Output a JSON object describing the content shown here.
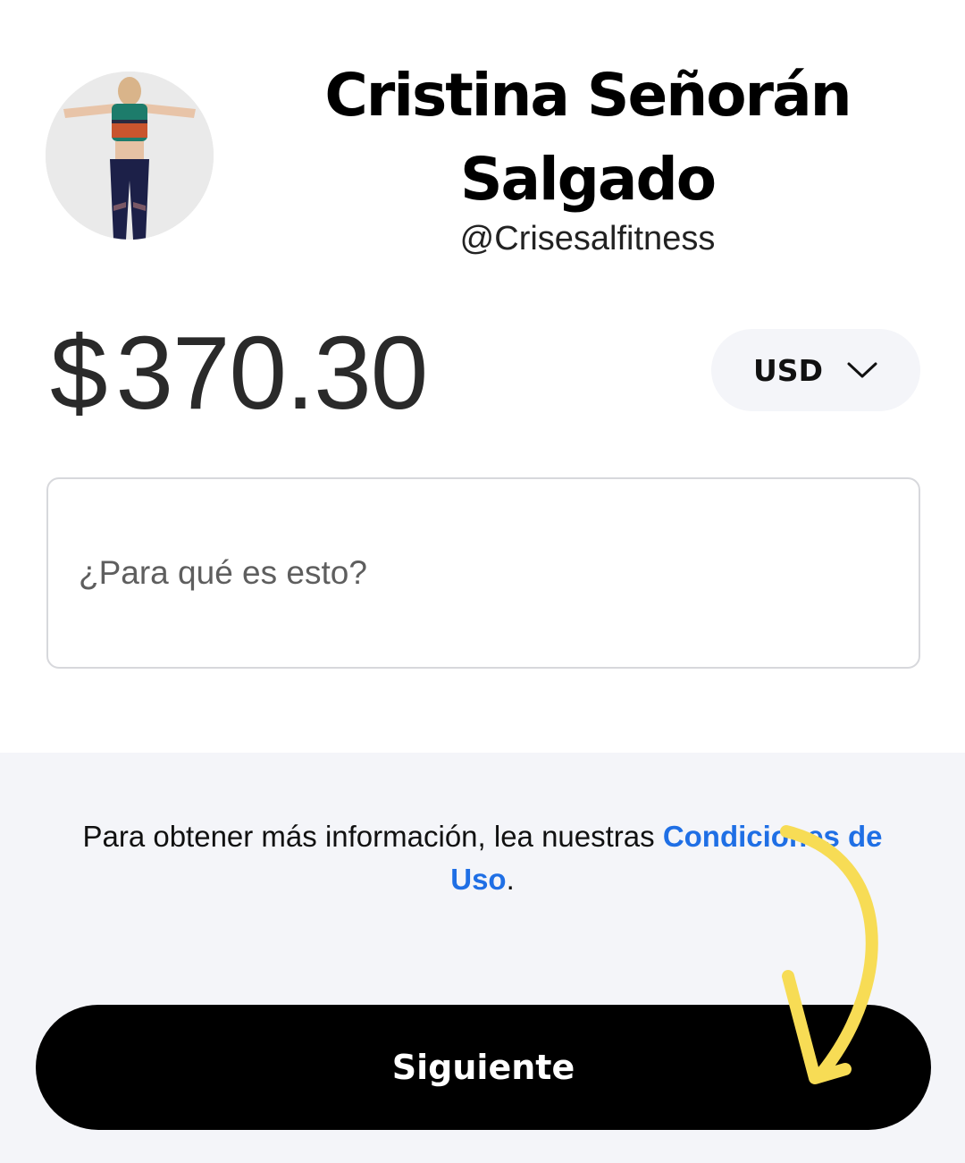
{
  "profile": {
    "name": "Cristina Señorán Salgado",
    "handle": "@Crisesalfitness"
  },
  "payment": {
    "currency_symbol": "$",
    "amount": "370.30",
    "currency_code": "USD",
    "purpose_placeholder": "¿Para qué es esto?"
  },
  "footer": {
    "terms_text": "Para obtener más información, lea nuestras ",
    "terms_link": "Condiciones de Uso",
    "terms_end": ".",
    "next_label": "Siguiente"
  },
  "colors": {
    "link": "#1f6fe5",
    "button": "#000000",
    "panel": "#f4f5f9",
    "annotation_arrow": "#f7dc55"
  },
  "icons": {
    "currency_dropdown": "chevron-down-icon",
    "annotation": "curved-arrow-icon"
  }
}
